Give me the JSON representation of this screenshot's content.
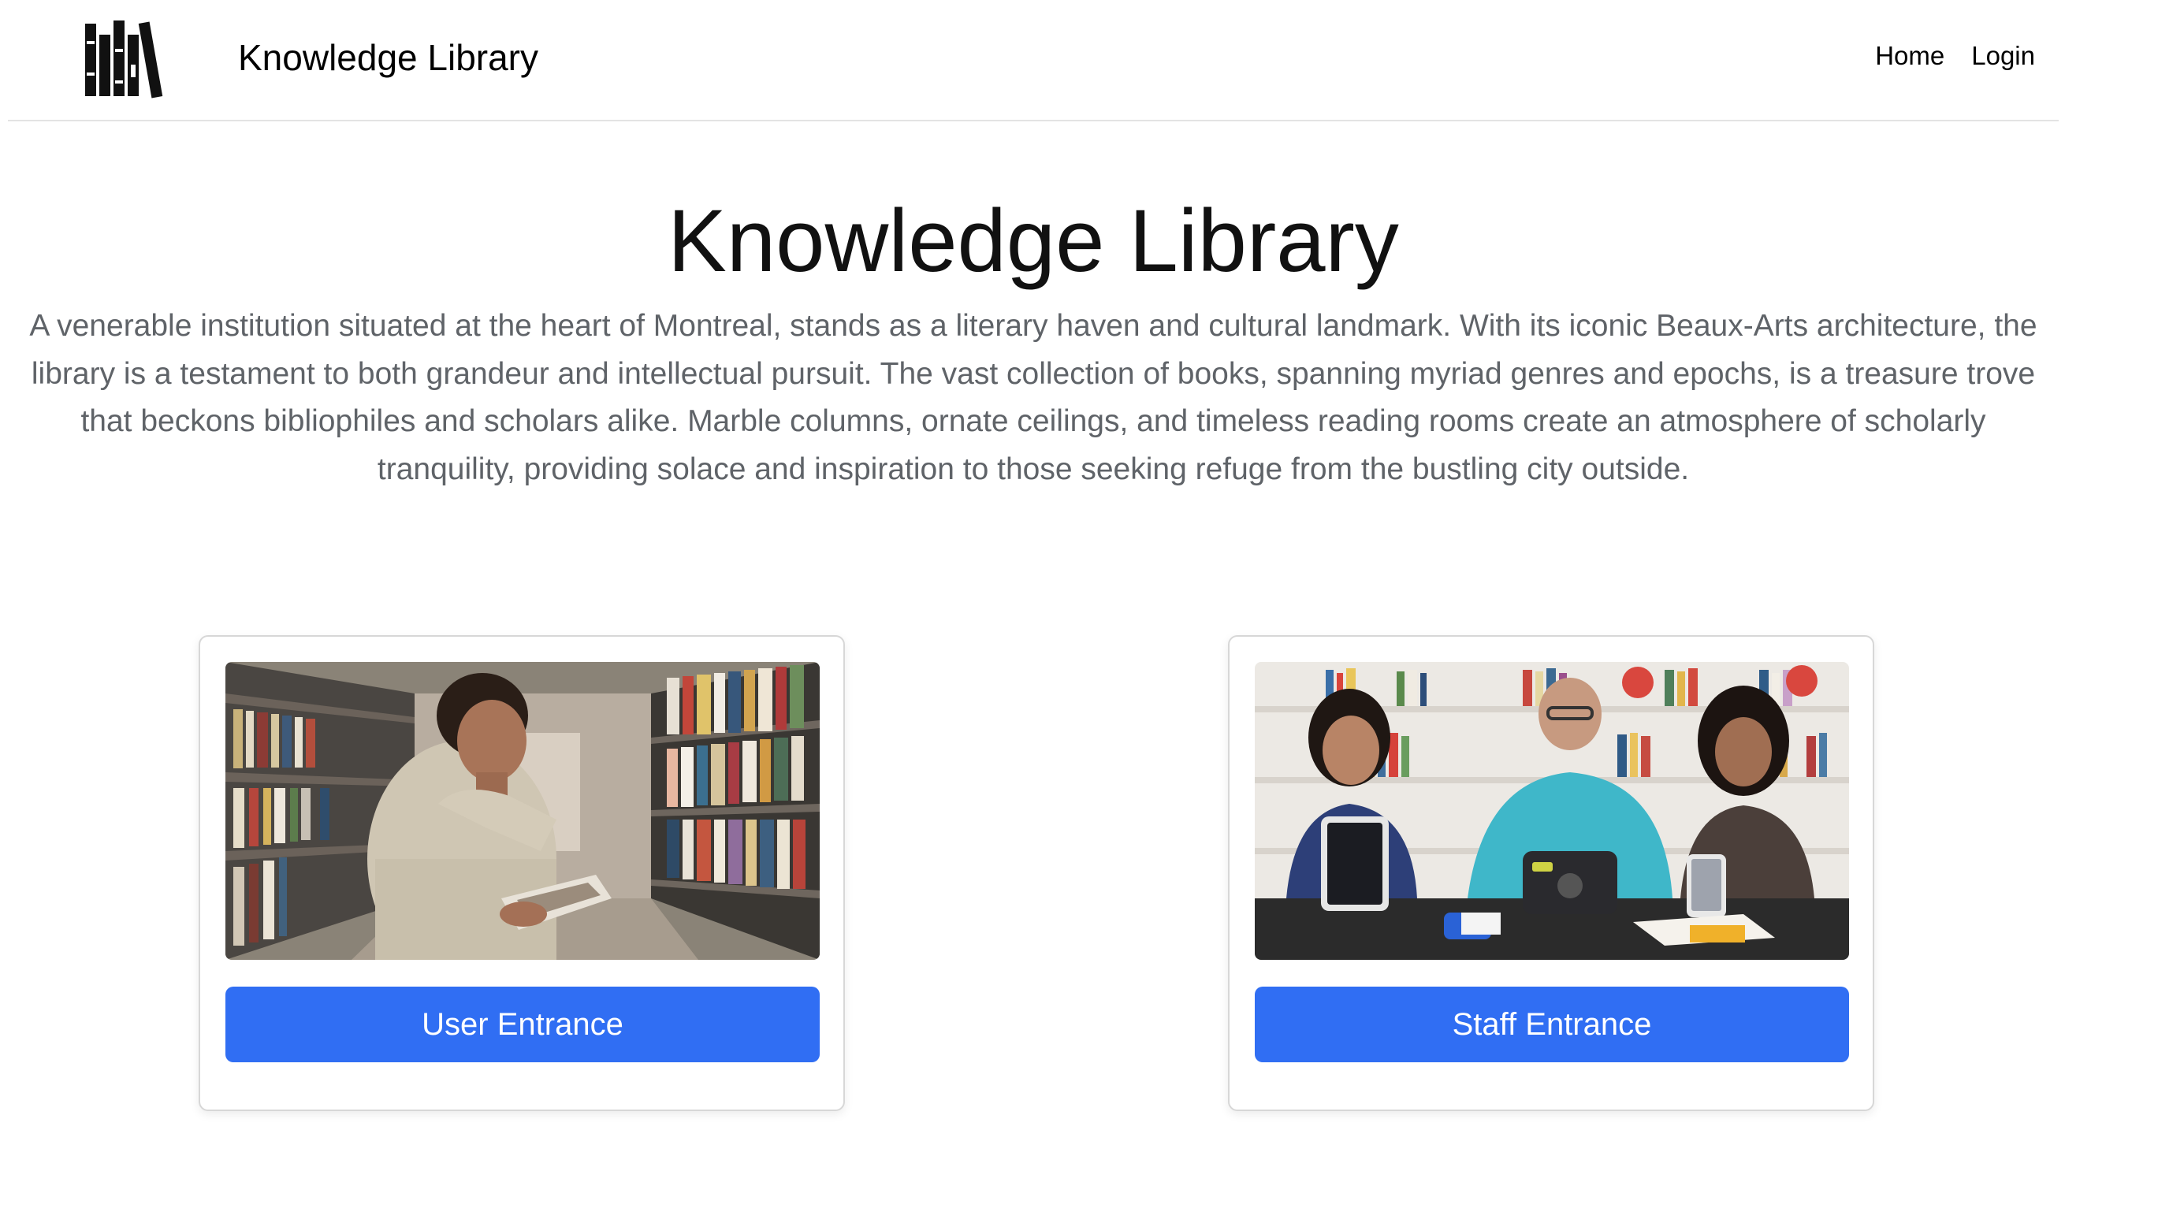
{
  "header": {
    "brand_name": "Knowledge Library",
    "logo_icon": "books-icon",
    "nav": [
      {
        "label": "Home"
      },
      {
        "label": "Login"
      }
    ]
  },
  "hero": {
    "title": "Knowledge Library",
    "description": "A venerable institution situated at the heart of Montreal, stands as a literary haven and cultural landmark. With its iconic Beaux-Arts architecture, the library is a testament to both grandeur and intellectual pursuit. The vast collection of books, spanning myriad genres and epochs, is a treasure trove that beckons bibliophiles and scholars alike. Marble columns, ornate ceilings, and timeless reading rooms create an atmosphere of scholarly tranquility, providing solace and inspiration to those seeking refuge from the bustling city outside."
  },
  "cards": [
    {
      "button_label": "User Entrance",
      "photo": "student-reading-in-library-aisle"
    },
    {
      "button_label": "Staff Entrance",
      "photo": "three-staff-with-tablets-at-table"
    }
  ],
  "colors": {
    "accent": "#306ef3",
    "description_text": "#5f6368"
  }
}
